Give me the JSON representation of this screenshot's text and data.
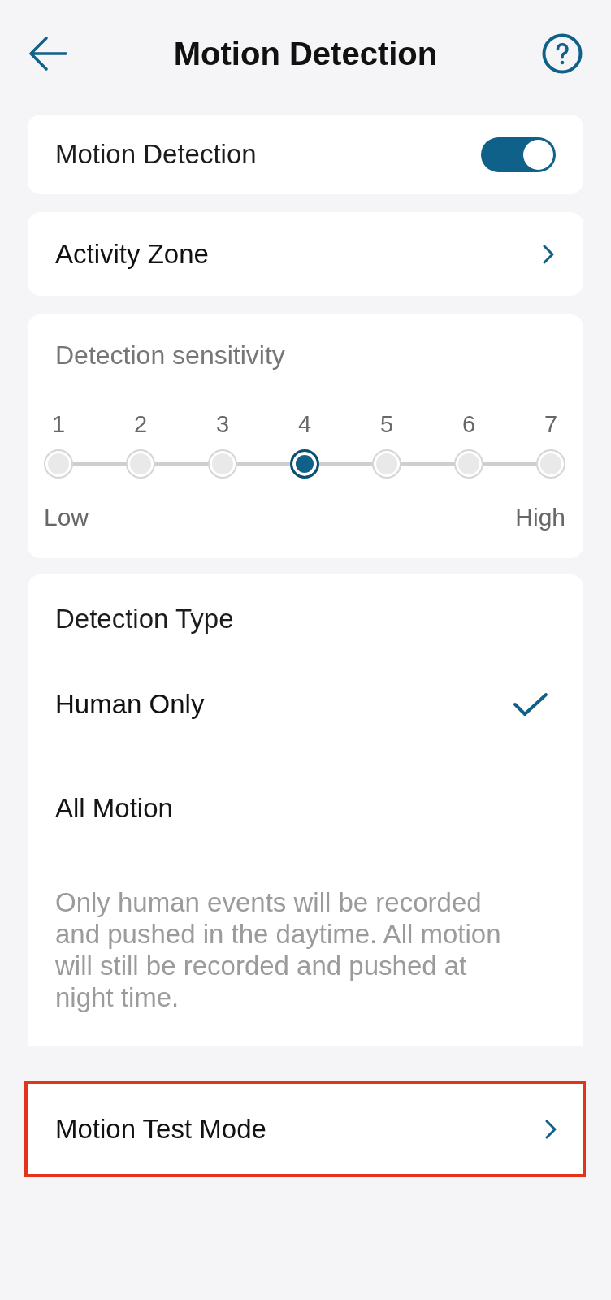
{
  "header": {
    "title": "Motion Detection"
  },
  "motion_detection": {
    "label": "Motion Detection",
    "on": true
  },
  "activity_zone": {
    "label": "Activity Zone"
  },
  "sensitivity": {
    "label": "Detection sensitivity",
    "steps": [
      {
        "label": "1",
        "selected": false
      },
      {
        "label": "2",
        "selected": false
      },
      {
        "label": "3",
        "selected": false
      },
      {
        "label": "4",
        "selected": true
      },
      {
        "label": "5",
        "selected": false
      },
      {
        "label": "6",
        "selected": false
      },
      {
        "label": "7",
        "selected": false
      }
    ],
    "low_label": "Low",
    "high_label": "High"
  },
  "detection_type": {
    "title": "Detection Type",
    "options": [
      {
        "label": "Human Only",
        "selected": true
      },
      {
        "label": "All Motion",
        "selected": false
      }
    ],
    "description": "Only human events will be recorded and pushed in the daytime. All motion will still be recorded and pushed at night time."
  },
  "test_mode": {
    "label": "Motion Test Mode",
    "highlighted": true
  }
}
